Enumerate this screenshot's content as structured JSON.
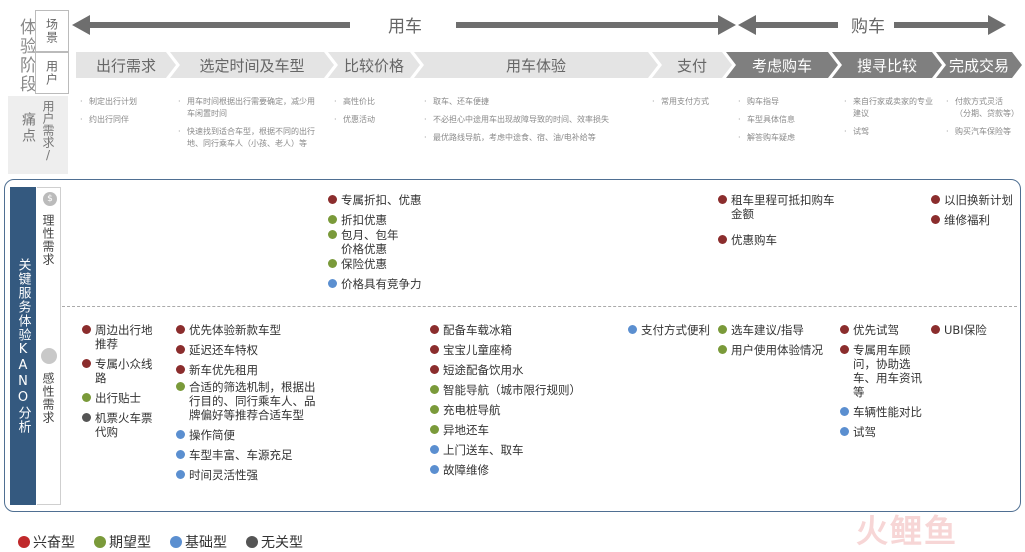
{
  "left_header": {
    "stage_label": "体验阶段",
    "scene_label": "场景",
    "user_label": "用户",
    "pain_label": "痛点",
    "needs_label": "用户需求/"
  },
  "phases": {
    "use_car": "用车",
    "buy_car": "购车"
  },
  "stages": [
    {
      "label": "出行需求",
      "style": "light"
    },
    {
      "label": "选定时间及车型",
      "style": "light"
    },
    {
      "label": "比较价格",
      "style": "light"
    },
    {
      "label": "用车体验",
      "style": "light"
    },
    {
      "label": "支付",
      "style": "light"
    },
    {
      "label": "考虑购车",
      "style": "dark"
    },
    {
      "label": "搜寻比较",
      "style": "dark"
    },
    {
      "label": "完成交易",
      "style": "dark"
    }
  ],
  "pain_points": [
    [
      "制定出行计划",
      "约出行同伴"
    ],
    [
      "用车时间根据出行需要确定，减少用车闲置时间",
      "快速找到适合车型，根据不同的出行地、同行乘车人（小孩、老人）等"
    ],
    [
      "高性价比",
      "优惠活动"
    ],
    [
      "取车、还车便捷",
      "不必担心中途用车出现故障导致的时间、效率损失",
      "最优路线导航，考虑中途食、宿、油/电补给等"
    ],
    [
      "常用支付方式"
    ],
    [
      "购车指导",
      "车型具体信息",
      "解答购车疑虑"
    ],
    [
      "来自行家或卖家的专业建议",
      "试驾"
    ],
    [
      "付款方式灵活（分期、贷款等）",
      "购买汽车保险等"
    ]
  ],
  "kano": {
    "title": "关键服务体验KANO分析",
    "rational_label": "理性需求",
    "perceptual_label": "感性需求"
  },
  "rational": {
    "compare_price": [
      {
        "text": "专属折扣、优惠",
        "type": "red"
      },
      {
        "text": "折扣优惠",
        "type": "green"
      },
      {
        "text": "包月、包年价格优惠",
        "type": "green"
      },
      {
        "text": "保险优惠",
        "type": "green"
      },
      {
        "text": "价格具有竞争力",
        "type": "blue"
      }
    ],
    "consider_buy": [
      {
        "text": "租车里程可抵扣购车金额",
        "type": "red"
      },
      {
        "text": "优惠购车",
        "type": "red"
      }
    ],
    "complete_deal": [
      {
        "text": "以旧换新计划",
        "type": "red"
      },
      {
        "text": "维修福利",
        "type": "red"
      }
    ]
  },
  "perceptual": {
    "travel_need": [
      {
        "text": "周边出行地推荐",
        "type": "red"
      },
      {
        "text": "专属小众线路",
        "type": "red"
      },
      {
        "text": "出行贴士",
        "type": "green"
      },
      {
        "text": "机票火车票代购",
        "type": "gray"
      }
    ],
    "select_time": [
      {
        "text": "优先体验新款车型",
        "type": "red"
      },
      {
        "text": "延迟还车特权",
        "type": "red"
      },
      {
        "text": "新车优先租用",
        "type": "red"
      },
      {
        "text": "合适的筛选机制，根据出行目的、同行乘车人、品牌偏好等推荐合适车型",
        "type": "green"
      },
      {
        "text": "操作简便",
        "type": "blue"
      },
      {
        "text": "车型丰富、车源充足",
        "type": "blue"
      },
      {
        "text": "时间灵活性强",
        "type": "blue"
      }
    ],
    "experience": [
      {
        "text": "配备车载冰箱",
        "type": "red"
      },
      {
        "text": "宝宝儿童座椅",
        "type": "red"
      },
      {
        "text": "短途配备饮用水",
        "type": "red"
      },
      {
        "text": "智能导航（城市限行规则）",
        "type": "green"
      },
      {
        "text": "充电桩导航",
        "type": "green"
      },
      {
        "text": "异地还车",
        "type": "green"
      },
      {
        "text": "上门送车、取车",
        "type": "blue"
      },
      {
        "text": "故障维修",
        "type": "blue"
      }
    ],
    "pay": [
      {
        "text": "支付方式便利",
        "type": "blue"
      }
    ],
    "consider_buy": [
      {
        "text": "选车建议/指导",
        "type": "green"
      },
      {
        "text": "用户使用体验情况",
        "type": "green"
      }
    ],
    "search_compare": [
      {
        "text": "优先试驾",
        "type": "red"
      },
      {
        "text": "专属用车顾问，协助选车、用车资讯等",
        "type": "red"
      },
      {
        "text": "车辆性能对比",
        "type": "blue"
      },
      {
        "text": "试驾",
        "type": "blue"
      }
    ],
    "complete_deal": [
      {
        "text": "UBI保险",
        "type": "red"
      }
    ]
  },
  "legend": [
    {
      "label": "兴奋型",
      "type": "red"
    },
    {
      "label": "期望型",
      "type": "green"
    },
    {
      "label": "基础型",
      "type": "blue"
    },
    {
      "label": "无关型",
      "type": "gray"
    }
  ],
  "watermark": "火鲤鱼",
  "colors": {
    "red": "#8b2d2d",
    "green": "#7a9a3a",
    "blue": "#5b8fd0",
    "gray": "#555555",
    "kano_bar": "#34597f",
    "panel_border": "#4f6f92"
  }
}
